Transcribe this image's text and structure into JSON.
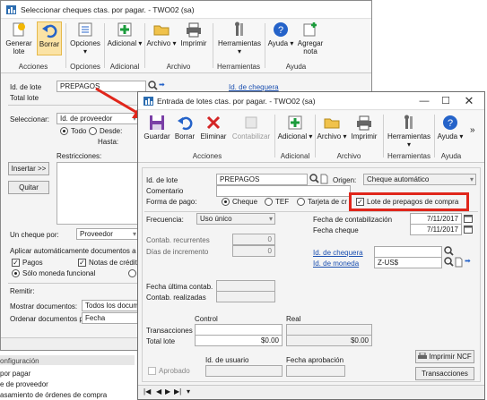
{
  "back_window": {
    "title": "Seleccionar cheques ctas. por pagar.  -  TWO02 (sa)",
    "ribbon": {
      "groups": [
        "Acciones",
        "Opciones",
        "Adicional",
        "Archivo",
        "Herramientas",
        "Ayuda"
      ],
      "buttons": [
        "Generar lote",
        "Borrar",
        "Opciones",
        "Adicional",
        "Archivo",
        "Imprimir",
        "Herramientas",
        "Ayuda",
        "Agregar nota"
      ]
    },
    "fields": {
      "batch_id_label": "Id. de lote",
      "batch_id_value": "PREPAGOS",
      "total_batch_label": "Total lote",
      "checkbook_link": "Id. de chequera",
      "select_label": "Seleccionar:",
      "select_value": "Id. de proveedor",
      "radio_all": "Todo",
      "radio_from": "Desde:",
      "to_label": "Hasta:",
      "restrictions_label": "Restricciones:",
      "insert_button": "Insertar >>",
      "remove_button": "Quitar",
      "one_check_label": "Un cheque por:",
      "one_check_value": "Proveedor",
      "apply_auto_label": "Aplicar automáticamente documentos a no aplic",
      "payments_check": "Pagos",
      "credit_notes_check": "Notas de crédito",
      "functional_currency_radio": "Sólo moneda funcional",
      "remit_label": "Remitir:",
      "show_docs_label": "Mostrar documentos:",
      "show_docs_value": "Todos los documen",
      "order_docs_label": "Ordenar documentos por:",
      "order_docs_value": "Fecha"
    }
  },
  "side_panel": {
    "header": "onfiguración",
    "items": [
      "por pagar",
      "e de proveedor",
      "asamiento de órdenes de compra"
    ]
  },
  "front_window": {
    "title": "Entrada de lotes ctas. por pagar.  -  TWO02 (sa)",
    "ribbon": {
      "buttons": [
        "Guardar",
        "Borrar",
        "Eliminar",
        "Contabilizar",
        "Adicional",
        "Archivo",
        "Imprimir",
        "Herramientas",
        "Ayuda"
      ],
      "groups": [
        "Acciones",
        "Adicional",
        "Archivo",
        "Herramientas",
        "Ayuda"
      ],
      "more": "»"
    },
    "form": {
      "batch_id_label": "Id. de lote",
      "batch_id_value": "PREPAGOS",
      "origin_label": "Origen:",
      "origin_value": "Cheque automático",
      "comment_label": "Comentario",
      "payment_form_label": "Forma de pago:",
      "pay_check": "Cheque",
      "pay_eft": "TEF",
      "pay_card": "Tarjeta de cr",
      "prepay_batch_check": "Lote de prepagos de compra",
      "frequency_label": "Frecuencia:",
      "frequency_value": "Uso único",
      "recurring_label": "Contab. recurrentes",
      "recurring_value": "0",
      "increment_label": "Días de incremento",
      "increment_value": "0",
      "posting_date_label": "Fecha de contabilización",
      "posting_date_value": "7/11/2017",
      "check_date_label": "Fecha cheque",
      "check_date_value": "7/11/2017",
      "checkbook_link": "Id. de chequera",
      "currency_link": "Id. de moneda",
      "currency_value": "Z-US$",
      "last_posting_label": "Fecha última contab.",
      "postings_done_label": "Contab. realizadas",
      "control_header": "Control",
      "real_header": "Real",
      "transactions_label": "Transacciones",
      "total_batch_label": "Total lote",
      "control_total": "$0.00",
      "real_total": "$0.00",
      "approved_label": "Aprobado",
      "user_id_label": "Id. de usuario",
      "approval_date_label": "Fecha aprobación",
      "print_ncf_button": "Imprimir NCF",
      "transactions_button": "Transacciones"
    },
    "nav": [
      "|◀",
      "◀",
      "▶",
      "▶|",
      "▾"
    ]
  },
  "colors": {
    "highlight": "#e0261b",
    "link": "#1a4fb0",
    "title_bg": "#ffffff"
  }
}
